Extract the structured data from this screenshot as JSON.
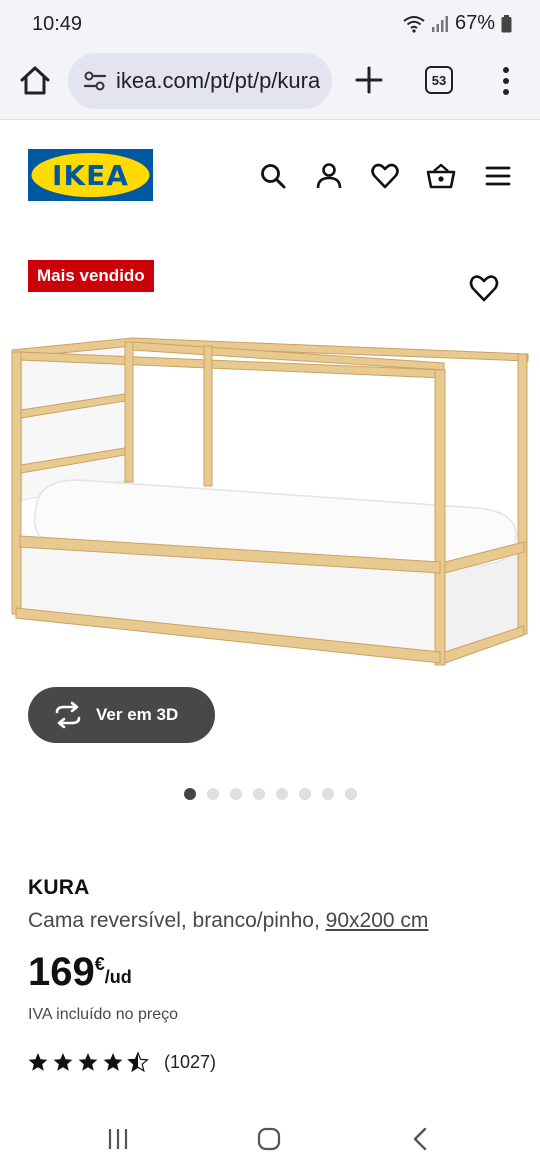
{
  "status_bar": {
    "time": "10:49",
    "battery": "67%"
  },
  "browser": {
    "url": "ikea.com/pt/pt/p/kura",
    "tab_count": "53"
  },
  "header": {
    "logo_text": "IKEA"
  },
  "product": {
    "badge": "Mais vendido",
    "view_3d_label": "Ver em 3D",
    "image_count": 8,
    "active_image": 1,
    "name": "KURA",
    "description": "Cama reversível, branco/pinho,",
    "size": "90x200 cm",
    "price": "169",
    "currency": "€",
    "unit": "/ud",
    "vat_note": "IVA incluído no preço",
    "rating": 4.5,
    "rating_max": 5,
    "review_count": "(1027)"
  },
  "colors": {
    "brand_blue": "#0058a3",
    "brand_yellow": "#ffdb00",
    "badge_red": "#cc0008",
    "button_dark": "#484848"
  },
  "icons": [
    "home-icon",
    "tune-icon",
    "plus-icon",
    "tabs-icon",
    "more-vert-icon",
    "search-icon",
    "user-icon",
    "heart-icon",
    "basket-icon",
    "menu-icon",
    "rotate-3d-icon",
    "star-icon",
    "recents-icon",
    "home-circle-icon",
    "back-icon"
  ]
}
